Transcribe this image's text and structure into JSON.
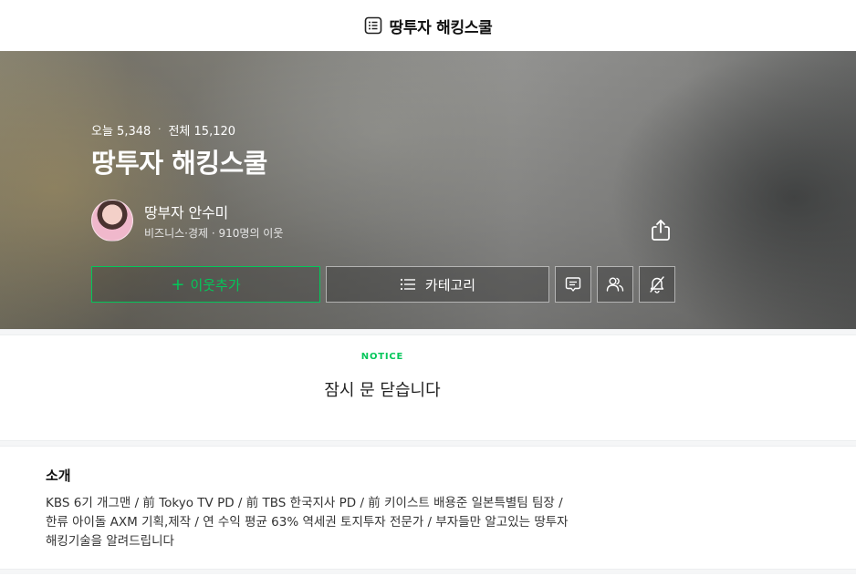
{
  "topbar": {
    "title": "땅투자 해킹스쿨",
    "icon": "list-box-icon"
  },
  "hero": {
    "today_label": "오늘 5,348",
    "separator": "·",
    "total_label": "전체 15,120",
    "blog_title": "땅투자 해킹스쿨",
    "nickname": "땅부자 안수미",
    "meta": "비즈니스·경제 · 910명의 이웃",
    "follow_label": "이웃추가",
    "category_label": "카테고리",
    "accent_color": "#03c75a"
  },
  "notice": {
    "label": "NOTICE",
    "text": "잠시 문 닫습니다"
  },
  "intro": {
    "heading": "소개",
    "body": "KBS 6기 개그맨 / 前 Tokyo TV PD / 前 TBS 한국지사 PD / 前 키이스트 배용준 일본특별팀 팀장 /\n한류 아이돌 AXM 기획,제작 / 연 수익 평균 63% 역세권 토지투자 전문가 / 부자들만 알고있는 땅투자\n해킹기술을 알려드립니다"
  }
}
